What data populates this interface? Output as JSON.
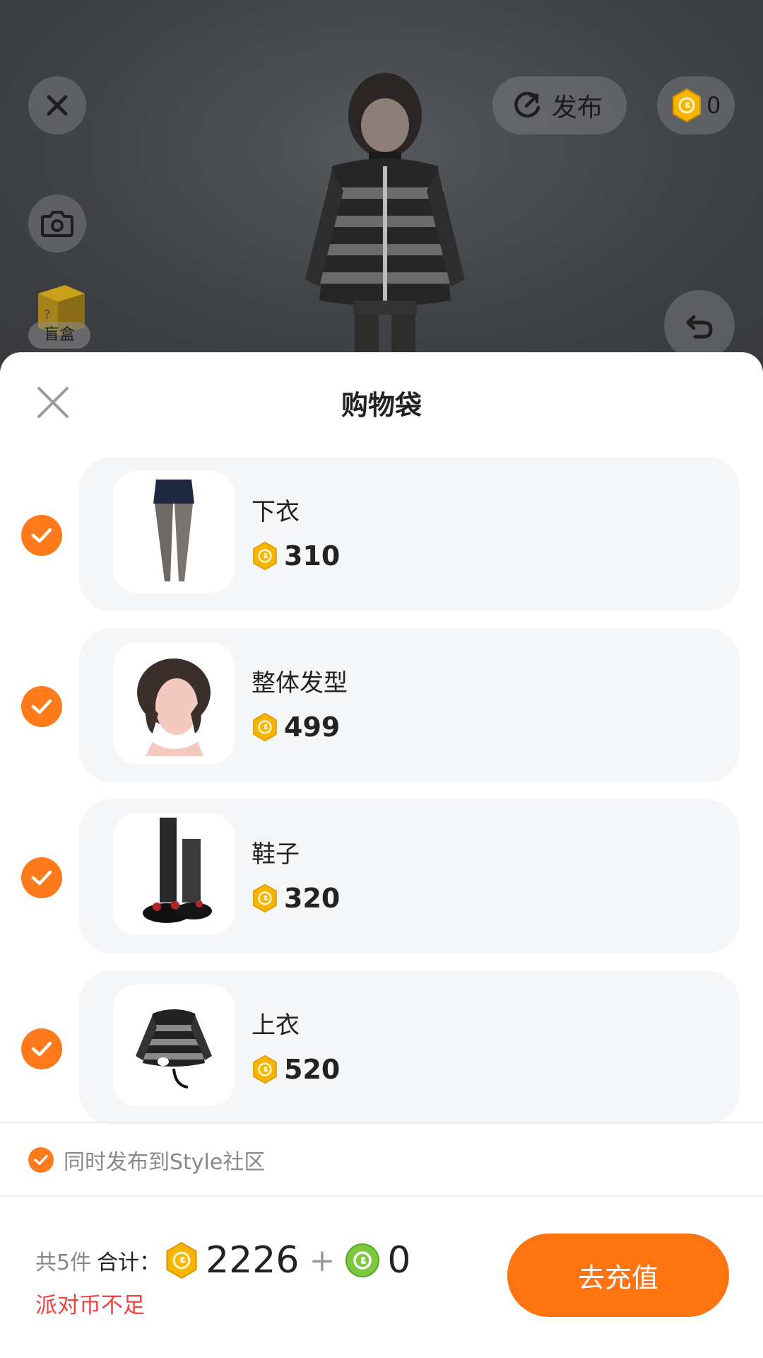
{
  "scene": {
    "publish_label": "发布",
    "coin_balance": "0",
    "blindbox_label": "盲盒"
  },
  "sheet": {
    "title": "购物袋",
    "items": [
      {
        "name": "下衣",
        "price": "310",
        "checked": true,
        "icon": "shorts-tights-icon"
      },
      {
        "name": "整体发型",
        "price": "499",
        "checked": true,
        "icon": "hairstyle-icon"
      },
      {
        "name": "鞋子",
        "price": "320",
        "checked": true,
        "icon": "shoes-icon"
      },
      {
        "name": "上衣",
        "price": "520",
        "checked": true,
        "icon": "striped-hoodie-icon"
      }
    ],
    "publish_option": "同时发布到Style社区"
  },
  "summary": {
    "count_text": "共5件",
    "total_label": "合计：",
    "gold_total": "2226",
    "plus": "+",
    "green_total": "0",
    "warning": "派对币不足",
    "button_label": "去充值"
  },
  "colors": {
    "accent": "#ff7410",
    "warning": "#f2433f",
    "gold_coin": "#f7b500",
    "green_coin": "#7cc93e"
  }
}
